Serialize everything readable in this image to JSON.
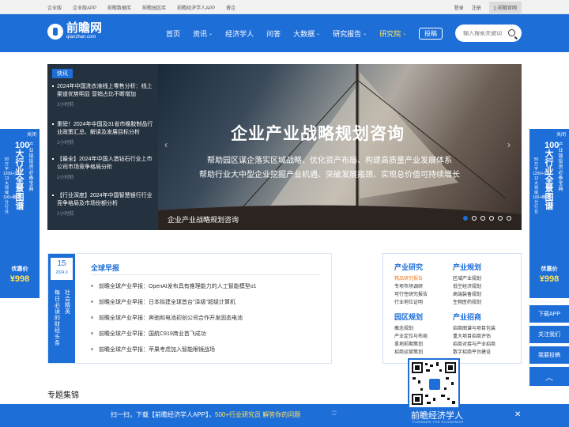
{
  "topbar": {
    "links": [
      "企业版",
      "企业版APP",
      "前瞻数据库",
      "前瞻园区库",
      "前瞻经济学人APP",
      "睿企"
    ],
    "login": "登录",
    "register": "注册",
    "official": "前瞻官网"
  },
  "header": {
    "logo_cn": "前瞻网",
    "logo_en": "qianzhan.com",
    "nav": [
      "首页",
      "资讯",
      "经济学人",
      "问答",
      "大数据",
      "研究报告",
      "研究院"
    ],
    "post": "投稿",
    "search_placeholder": "输入搜索关键词"
  },
  "flash": {
    "tag": "快讯",
    "items": [
      {
        "title": "2024年中国洗衣液线上零售分析：线上渠道优势明显 营销占比不断增加",
        "time": "1小时前"
      },
      {
        "title": "重磅！2024年中国及31省市橡胶制品行业政策汇总、解读及发展目标分析",
        "time": "1小时前"
      },
      {
        "title": "【最全】2024年中国人造钻石行业上市公司市场竞争格局分析",
        "time": "1小时前"
      },
      {
        "title": "【行业深度】2024年中国智慧银行行业竞争格局及市场份额分析",
        "time": "1小时前"
      }
    ]
  },
  "banner": {
    "title": "企业产业战略规划咨询",
    "line1": "帮助园区谋企落实区域战略、优化资产布局、构建高质量产业发展体系",
    "line2": "帮助行业大中型企业挖掘产业机遇、突破发展瓶颈、实现总价值可持续增长",
    "caption": "企业产业战略规划咨询",
    "slide_count": 6,
    "active_slide": 1
  },
  "side_ad": {
    "close": "关闭",
    "big": "100大行业全景图谱",
    "small_a": "产业链投资必备宝典",
    "small_b": "50万字1200+页13大领域100+细分行业",
    "offer": "优惠价",
    "price": "¥998"
  },
  "report": {
    "day": "15",
    "year_month": "2024.9",
    "col_a": "社会精英",
    "col_b": "每日必读的财经头条",
    "title": "全球早报",
    "items": [
      "前瞻全球产业早报：OpenAI发布具有推理能力的人工智能模型o1",
      "前瞻全球产业早报：日本拟建全球首台\"泽级\"超级计算机",
      "前瞻全球产业早报：奔驰和电池初创公司合作开发固态电池",
      "前瞻全球产业早报：国航C919商业首飞成功",
      "前瞻全球产业早报：苹果考虑加入智能眼镜战场"
    ]
  },
  "service": {
    "col1": {
      "head1": "产业研究",
      "items1": [
        "精品研究报告",
        "专项市场调研",
        "可行性研究报告",
        "行业地位证明"
      ],
      "head2": "园区规划",
      "items2": [
        "概念规划",
        "产业定位与布局",
        "拿地前期策划",
        "招商运营策划"
      ]
    },
    "col2": {
      "head1": "产业规划",
      "items1": [
        "区域产业规划",
        "低空经济规划",
        "高端装备规划",
        "生物医药规划"
      ],
      "head2": "产业招商",
      "items2": [
        "招商图谱与项目包装",
        "重大项目招商评估",
        "招商对接与产业招商",
        "数字招商平台建设"
      ]
    },
    "highlight_color": "#f07c1e"
  },
  "tools": [
    "下载APP",
    "关注我们",
    "我要投稿"
  ],
  "section_title": "专题集锦",
  "bottom": {
    "prefix": "扫一扫，下载【前瞻经济学人APP】，",
    "highlight": "500+行业研究员 解答你的问题",
    "brand": "前瞻经济学人",
    "brand_en": "FORWARD THE ECONOMIST"
  },
  "colors": {
    "brand": "#1e6ed8",
    "accent": "#ffe35a"
  }
}
